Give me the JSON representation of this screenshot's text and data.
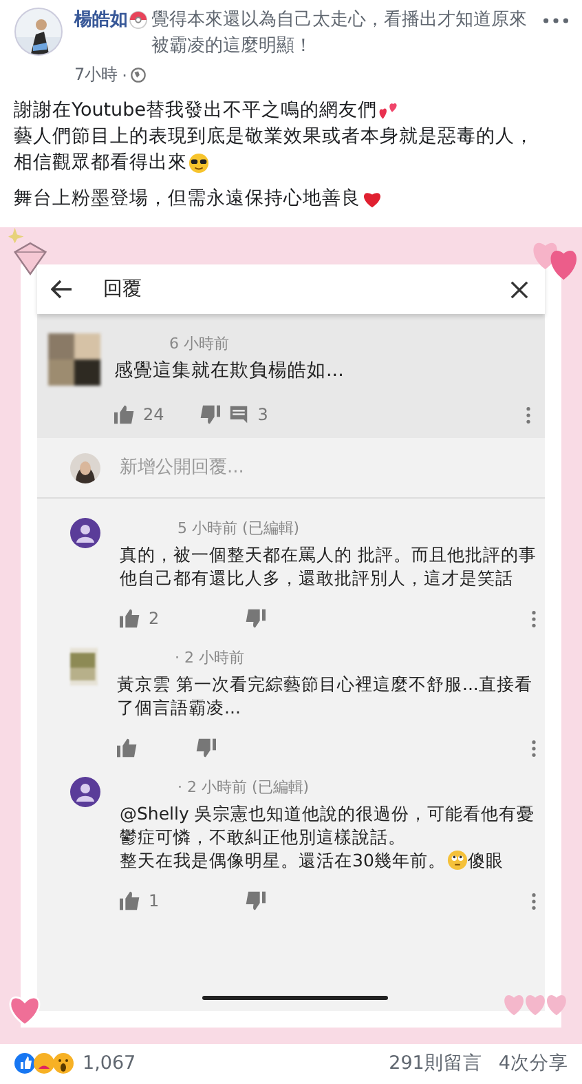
{
  "post": {
    "author": "楊皓如",
    "feeling": "覺得本來還以為自己太走心，看播出才知道原來被霸凌的這麼明顯！",
    "time": "7小時",
    "separator": "·",
    "paragraphs": [
      {
        "lines": [
          {
            "parts": [
              {
                "kind": "text",
                "text": "謝謝在Youtube替我發出不平之鳴的網友們"
              },
              {
                "kind": "two-hearts"
              }
            ]
          },
          {
            "parts": [
              {
                "kind": "text",
                "text": "藝人們節目上的表現到底是敬業效果或者本身就是惡毒的人，"
              }
            ]
          },
          {
            "parts": [
              {
                "kind": "text",
                "text": "相信觀眾都看得出來"
              },
              {
                "kind": "sunglasses"
              }
            ]
          }
        ]
      },
      {
        "lines": [
          {
            "parts": [
              {
                "kind": "text",
                "text": "舞台上粉墨登場，但需永遠保持心地善良"
              },
              {
                "kind": "heart"
              }
            ]
          }
        ]
      }
    ]
  },
  "embed": {
    "title": "回覆",
    "comment": {
      "time": "6 小時前",
      "text": "感覺這集就在欺負楊皓如...",
      "likes": "24",
      "replies": "3"
    },
    "reply_placeholder": "新增公開回覆...",
    "replies": [
      {
        "kind": "default-avatar",
        "time": "5 小時前 (已編輯)",
        "lines": [
          {
            "parts": [
              {
                "kind": "text",
                "text": "真的，被一個整天都在罵人的 批評。而且他批評的事他自己都有還比人多，還敢批評別人，這才是笑話"
              }
            ]
          }
        ],
        "likes": "2"
      },
      {
        "kind": "photo-avatar",
        "time": "· 2 小時前",
        "lines": [
          {
            "parts": [
              {
                "kind": "text",
                "text": "黃京雲 第一次看完綜藝節目心裡這麼不舒服...直接看了個言語霸凌..."
              }
            ]
          }
        ]
      },
      {
        "kind": "default-avatar",
        "time": "· 2 小時前 (已編輯)",
        "lines": [
          {
            "parts": [
              {
                "kind": "text",
                "text": "@Shelly 吳宗憲也知道他說的很過份，可能看他有憂鬱症可憐，不敢糾正他別這樣說話。"
              }
            ]
          },
          {
            "parts": [
              {
                "kind": "text",
                "text": "整天在我是偶像明星。還活在30幾年前。"
              },
              {
                "kind": "rolling-eyes"
              },
              {
                "kind": "text",
                "text": "傻眼"
              }
            ]
          }
        ],
        "likes": "1"
      }
    ]
  },
  "footer": {
    "reactions": "1,067",
    "comments": "291則留言",
    "shares": "4次分享"
  }
}
